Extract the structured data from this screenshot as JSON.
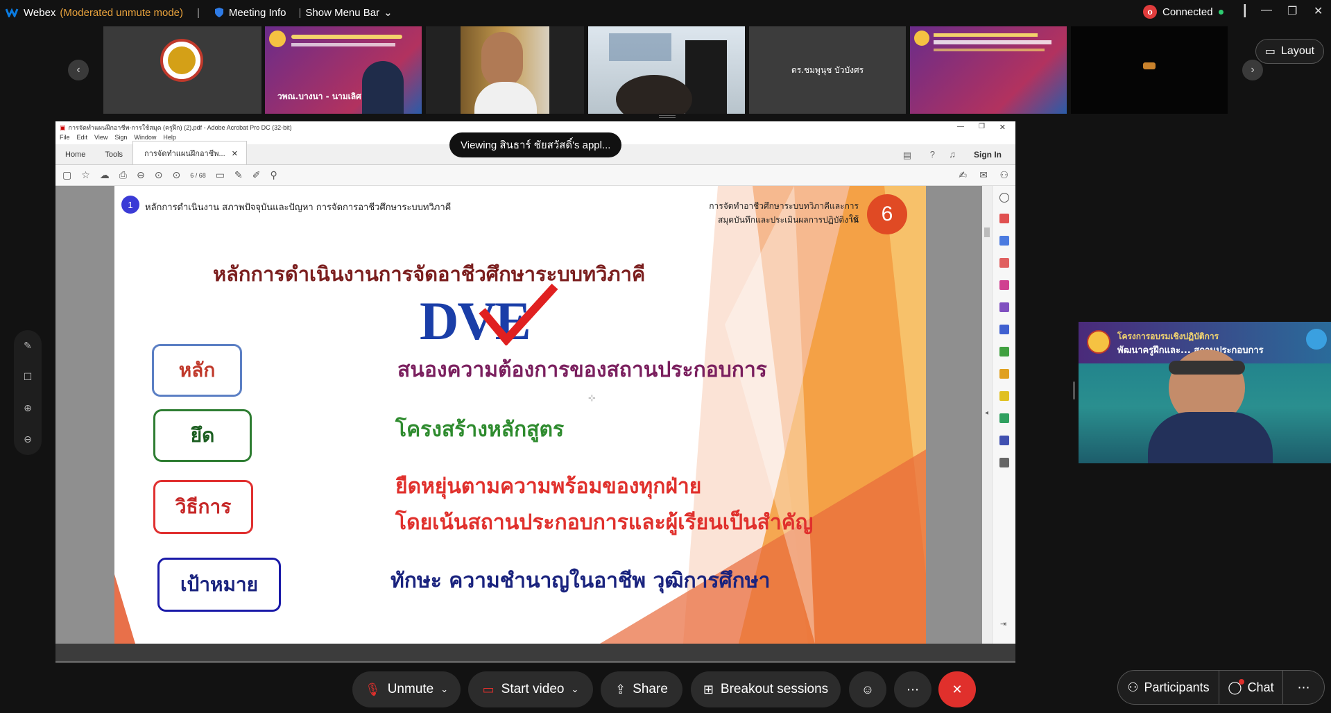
{
  "app": {
    "name": "Webex",
    "mode": "(Moderated unmute mode)",
    "meeting_info": "Meeting Info",
    "show_menu_bar": "Show Menu Bar",
    "status": "Connected",
    "rec_badge": "o"
  },
  "filmstrip": {
    "tiles": [
      {
        "label": ""
      },
      {
        "label": "วพณ.บางนา - นามเลิศ"
      },
      {
        "label": ""
      },
      {
        "label": ""
      },
      {
        "label": "ดร.ชมพูนุช บัวบังศร"
      },
      {
        "label": ""
      },
      {
        "label": ""
      }
    ],
    "layout_label": "Layout"
  },
  "viewing_banner": "Viewing สินธาร์ ชัยสวัสดิ์'s appl...",
  "acrobat": {
    "title": "การจัดทำแผนฝึกอาชีพ-การใช้สมุด (ครูฝึก) (2).pdf - Adobe Acrobat Pro DC (32-bit)",
    "menu": [
      "File",
      "Edit",
      "View",
      "Sign",
      "Window",
      "Help"
    ],
    "tabs": [
      "Home",
      "Tools"
    ],
    "active_tab": "การจัดทำแผนฝึกอาชีพ...",
    "sign_in": "Sign In",
    "page_current": "6",
    "page_total": "/ 68"
  },
  "slide": {
    "badge_number": "1",
    "header_left": "หลักการดำเนินงาน สภาพปัจจุบันและปัญหา การจัดการอาชีวศึกษาระบบทวิภาคี",
    "header_right_1": "การจัดทำอาชีวศึกษาระบบทวิภาคีและการใช้",
    "header_right_2": "สมุดบันทึกและประเมินผลการปฏิบัติงาน",
    "page_circle": "6",
    "main_title": "หลักการดำเนินงานการจัดอาชีวศึกษาระบบทวิภาคี",
    "logo_text": "DVE",
    "rows": [
      {
        "key": "หลัก",
        "text": "สนองความต้องการของสถานประกอบการ",
        "color": "#7a1f5e",
        "border": "#5b7fc4",
        "keycolor": "#c0392b"
      },
      {
        "key": "ยึด",
        "text": "โครงสร้างหลักสูตร",
        "color": "#2e8b2e",
        "border": "#2e7d32",
        "keycolor": "#1b5e20"
      },
      {
        "key": "วิธีการ",
        "text": "ยืดหยุ่นตามความพร้อมของทุกฝ่าย",
        "text2": "โดยเน้นสถานประกอบการและผู้เรียนเป็นสำคัญ",
        "color": "#e0302c",
        "border": "#e03030",
        "keycolor": "#c62828"
      },
      {
        "key": "เป้าหมาย",
        "text": "ทักษะ  ความชำนาญในอาชีพ   วุฒิการศึกษา",
        "color": "#1a237e",
        "border": "#1a1aa8",
        "keycolor": "#1a237e"
      }
    ]
  },
  "selfview": {
    "banner_title": "โครงการอบรมเชิงปฏิบัติการ",
    "banner_sub": "พัฒนาครูฝึกและ... สถานประกอบการ"
  },
  "controls": {
    "unmute": "Unmute",
    "start_video": "Start video",
    "share": "Share",
    "breakout": "Breakout sessions",
    "participants": "Participants",
    "chat": "Chat"
  },
  "colors": {
    "webex_blue": "#0a7be0",
    "moderated": "#e8a23c",
    "end_red": "#e0302c",
    "slide_orange": "#f39c3a"
  }
}
